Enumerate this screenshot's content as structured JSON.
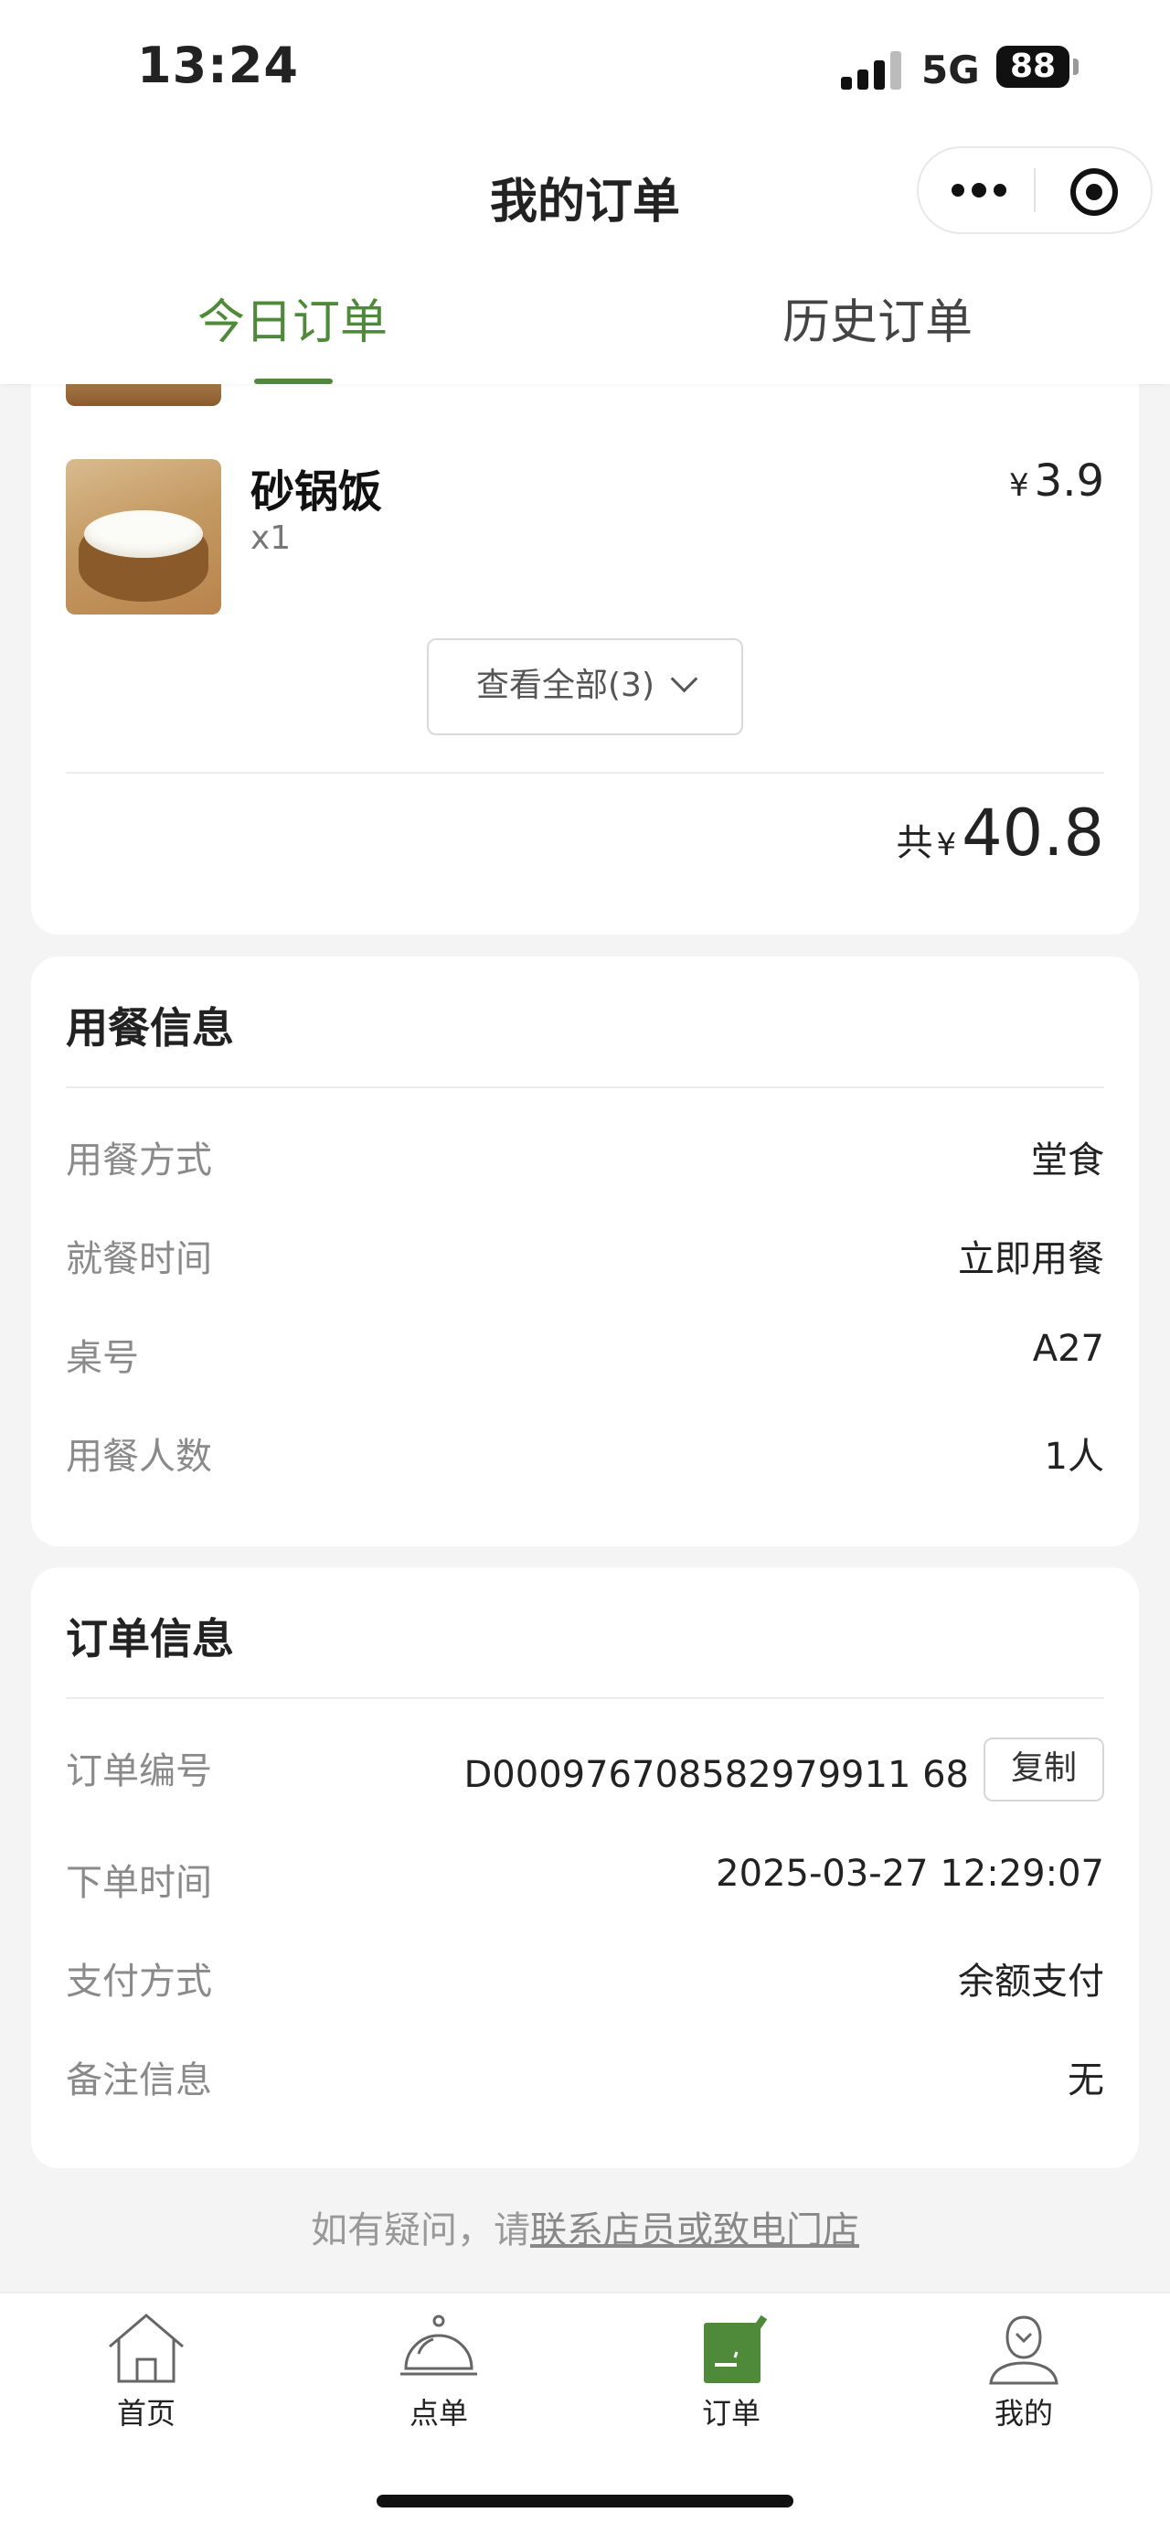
{
  "status": {
    "time": "13:24",
    "network": "5G",
    "battery": "88"
  },
  "header": {
    "title": "我的订单"
  },
  "tabs": [
    {
      "label": "今日订单",
      "active": true
    },
    {
      "label": "历史订单",
      "active": false
    }
  ],
  "items": {
    "dish": {
      "name": "砂锅饭",
      "qty": "x1",
      "currency": "¥",
      "price": "3.9"
    },
    "view_all": "查看全部(3)",
    "total_label": "共",
    "currency": "¥",
    "total": "40.8"
  },
  "dining": {
    "title": "用餐信息",
    "rows": [
      {
        "key": "用餐方式",
        "value": "堂食"
      },
      {
        "key": "就餐时间",
        "value": "立即用餐"
      },
      {
        "key": "桌号",
        "value": "A27"
      },
      {
        "key": "用餐人数",
        "value": "1人"
      }
    ]
  },
  "order": {
    "title": "订单信息",
    "rows": [
      {
        "key": "订单编号",
        "value": "D000976708582979911 68"
      },
      {
        "key": "下单时间",
        "value": "2025-03-27 12:29:07"
      },
      {
        "key": "支付方式",
        "value": "余额支付"
      },
      {
        "key": "备注信息",
        "value": "无"
      }
    ],
    "copy_label": "复制"
  },
  "help": {
    "prefix": "如有疑问，请",
    "link": "联系店员或致电门店"
  },
  "tabbar": [
    {
      "label": "首页",
      "icon": "home-icon"
    },
    {
      "label": "点单",
      "icon": "cloche-icon"
    },
    {
      "label": "订单",
      "icon": "order-edit-icon",
      "active_color": "#4f8a3a"
    },
    {
      "label": "我的",
      "icon": "profile-icon"
    }
  ]
}
